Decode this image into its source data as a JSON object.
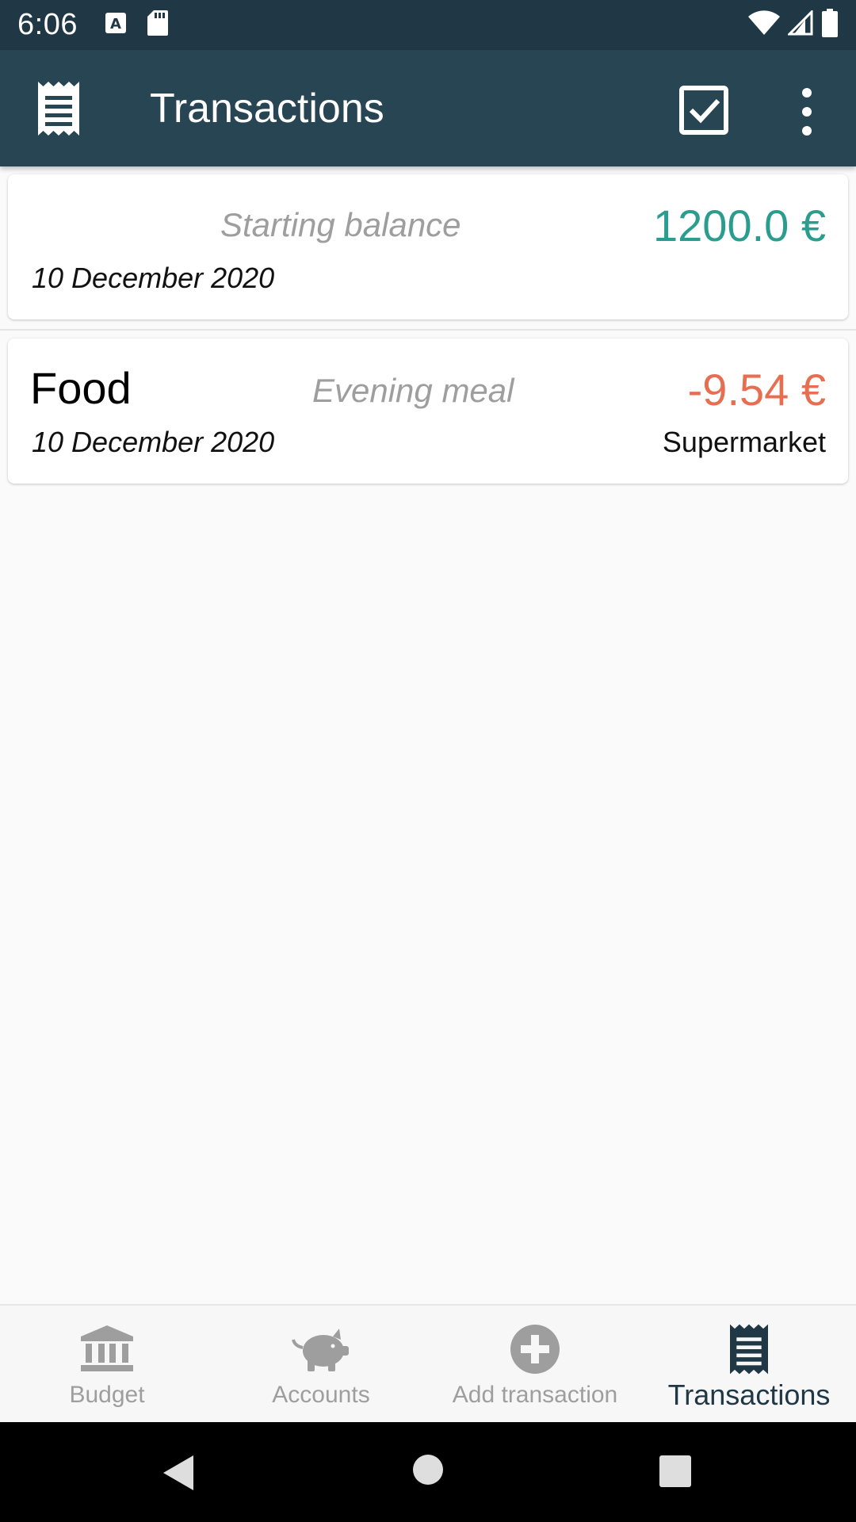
{
  "status_bar": {
    "time": "6:06",
    "icons": [
      "text-a-icon",
      "sd-card-icon",
      "wifi-icon",
      "signal-icon",
      "battery-icon"
    ]
  },
  "app_bar": {
    "title": "Transactions",
    "icons": [
      "receipt-icon",
      "checkbox-icon",
      "more-vert-icon"
    ]
  },
  "transactions": [
    {
      "description": "Starting balance",
      "date": "10 December 2020",
      "amount": "1200.0 €",
      "amount_color": "#2a9d8f"
    },
    {
      "category": "Food",
      "description": "Evening meal",
      "date": "10 December 2020",
      "amount": "-9.54 €",
      "amount_color": "#e76f51",
      "account": "Supermarket"
    }
  ],
  "bottom_nav": {
    "items": [
      {
        "label": "Budget",
        "icon": "bank-icon",
        "active": false
      },
      {
        "label": "Accounts",
        "icon": "piggy-bank-icon",
        "active": false
      },
      {
        "label": "Add transaction",
        "icon": "add-circle-icon",
        "active": false
      },
      {
        "label": "Transactions",
        "icon": "receipt-icon",
        "active": true
      }
    ]
  },
  "colors": {
    "status_bar": "#203845",
    "app_bar": "#284554",
    "positive": "#2a9d8f",
    "negative": "#e76f51",
    "nav_inactive": "#9e9e9e",
    "nav_active": "#203845"
  }
}
